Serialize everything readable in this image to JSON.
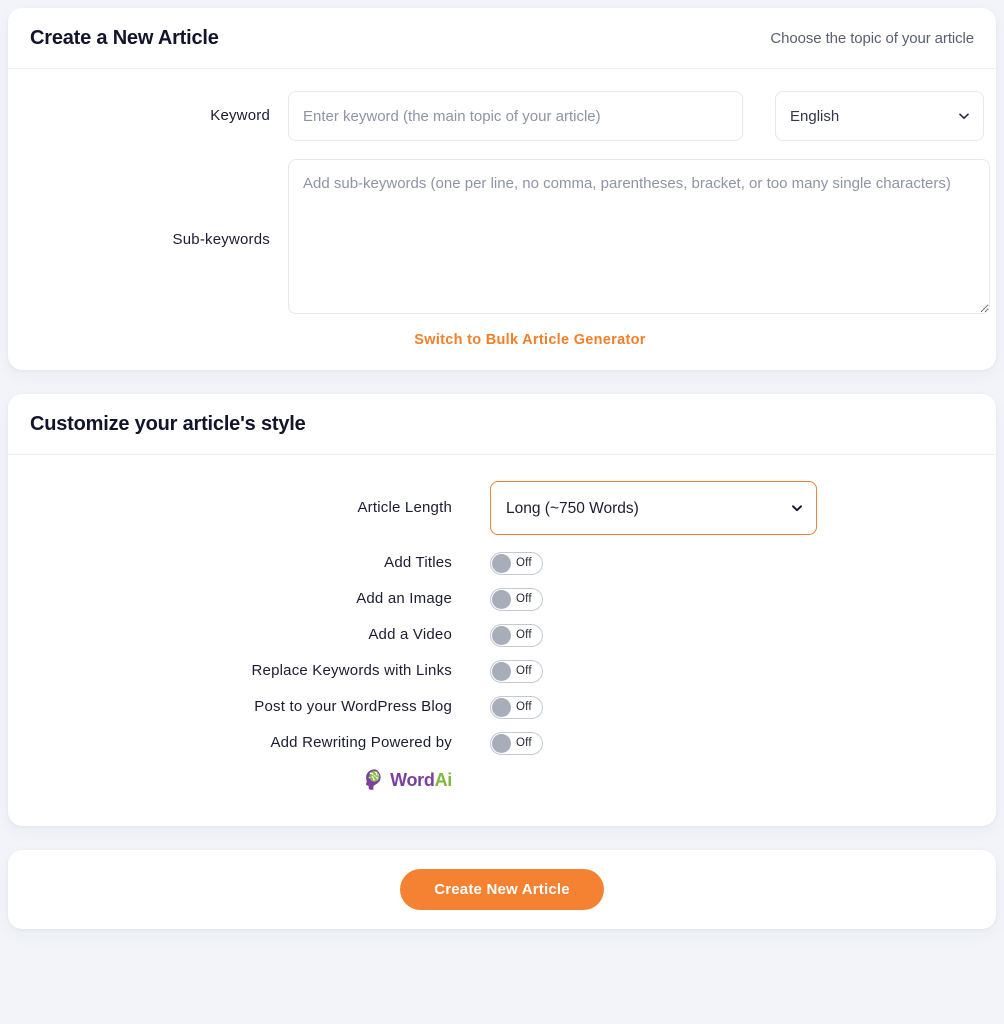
{
  "create_card": {
    "title": "Create a New Article",
    "subtitle": "Choose the topic of your article",
    "keyword": {
      "label": "Keyword",
      "value": "",
      "placeholder": "Enter keyword (the main topic of your article)"
    },
    "language": {
      "selected": "English",
      "options": [
        "English"
      ]
    },
    "sub_keywords": {
      "label": "Sub-keywords",
      "value": "",
      "placeholder": "Add sub-keywords (one per line, no comma, parentheses, bracket, or too many single characters)"
    },
    "bulk_link": "Switch to Bulk Article Generator"
  },
  "style_card": {
    "title": "Customize your article's style",
    "article_length": {
      "label": "Article Length",
      "selected": "Long (~750 Words)",
      "options": [
        "Long (~750 Words)"
      ]
    },
    "toggles": [
      {
        "label": "Add Titles",
        "state": "Off"
      },
      {
        "label": "Add an Image",
        "state": "Off"
      },
      {
        "label": "Add a Video",
        "state": "Off"
      },
      {
        "label": "Replace Keywords with Links",
        "state": "Off"
      },
      {
        "label": "Post to your WordPress Blog",
        "state": "Off"
      },
      {
        "label": "Add Rewriting Powered by",
        "state": "Off"
      }
    ],
    "wordai_logo": {
      "word": "Word",
      "ai": "Ai"
    }
  },
  "submit": {
    "label": "Create New Article"
  },
  "colors": {
    "accent": "#f58232",
    "accent_link": "#f47f29",
    "select_border": "#f08037",
    "page_bg": "#f2f4f9",
    "label_text": "#1b1d33",
    "logo_purple": "#7b3f9d",
    "logo_green": "#7cb83c"
  }
}
